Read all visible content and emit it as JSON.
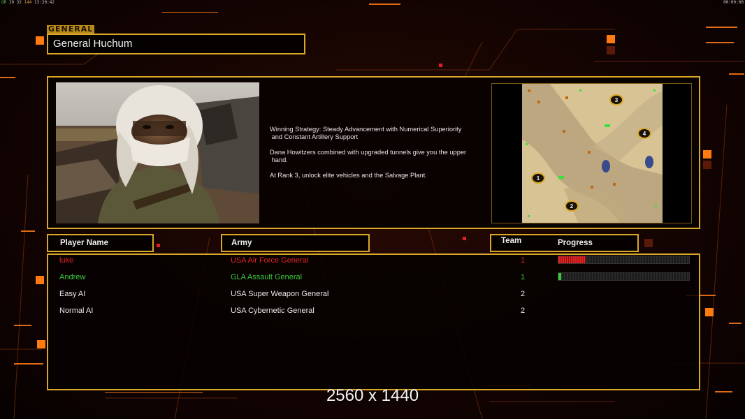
{
  "status_bar": {
    "left_segments": [
      "GR",
      "30",
      "32",
      "144",
      "13:20:42"
    ],
    "right_time": "00:00:00"
  },
  "general": {
    "tag": "GENERAL",
    "name": "General Huchum"
  },
  "description": {
    "paragraphs": [
      "Winning Strategy: Steady Advancement with Numerical Superiority\n and Constant Artillery Support",
      "Dana Howitzers combined with upgraded tunnels give you the upper\n hand.",
      "At Rank 3, unlock elite vehicles and the Salvage Plant."
    ]
  },
  "map": {
    "start_positions": [
      "1",
      "2",
      "3",
      "4"
    ]
  },
  "headers": {
    "player_name": "Player Name",
    "army": "Army",
    "team": "Team",
    "progress": "Progress"
  },
  "players": [
    {
      "name": "luke",
      "army": "USA Air Force General",
      "team": "1",
      "color": "#e02424",
      "progress": 0.21
    },
    {
      "name": "Andrew",
      "army": "GLA Assault General",
      "team": "1",
      "color": "#3cc83c",
      "progress": 0.02
    },
    {
      "name": "Easy AI",
      "army": "USA Super Weapon General",
      "team": "2",
      "color": "#f0f0f0"
    },
    {
      "name": "Normal AI",
      "army": "USA Cybernetic General",
      "team": "2",
      "color": "#f0f0f0"
    }
  ],
  "colors": {
    "frame": "#d9a72a",
    "accent_orange": "#ff7a10",
    "player_red": "#e02424",
    "player_green": "#3cc83c"
  },
  "resolution_label": "2560 x 1440"
}
